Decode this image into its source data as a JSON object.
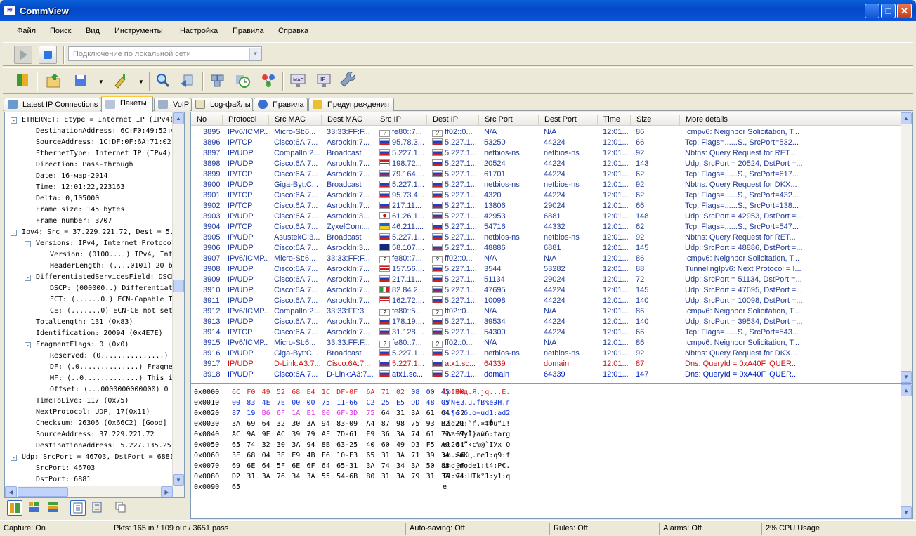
{
  "window": {
    "title": "CommView",
    "controls": [
      "minimize-icon",
      "maximize-icon",
      "close-icon"
    ]
  },
  "menu": [
    "Файл",
    "Поиск",
    "Вид",
    "Инструменты",
    "Настройка",
    "Правила",
    "Справка"
  ],
  "toolbar1": {
    "adapter_placeholder": "Подключение по локальной сети"
  },
  "tabs": [
    {
      "label": "Latest IP Connections",
      "icon": "ip-connections-icon"
    },
    {
      "label": "Пакеты",
      "icon": "packets-icon",
      "active": true
    },
    {
      "label": "VoIP",
      "icon": "voip-icon"
    },
    {
      "label": "Log-файлы",
      "icon": "log-icon"
    },
    {
      "label": "Правила",
      "icon": "rules-icon"
    },
    {
      "label": "Предупреждения",
      "icon": "alerts-icon"
    }
  ],
  "tree": [
    {
      "l": 0,
      "e": "-",
      "t": "ETHERNET: Etype = Internet IP (IPv4)"
    },
    {
      "l": 1,
      "t": "DestinationAddress: 6C:F0:49:52:68:E4"
    },
    {
      "l": 1,
      "t": "SourceAddress: 1C:DF:0F:6A:71:02"
    },
    {
      "l": 1,
      "t": "EthernetType: Internet IP (IPv4), 2048 (0x0800)"
    },
    {
      "l": 1,
      "t": "Direction: Pass-through"
    },
    {
      "l": 1,
      "t": "Date: 16-мар-2014"
    },
    {
      "l": 1,
      "t": "Time: 12:01:22,223163"
    },
    {
      "l": 1,
      "t": "Delta: 0,105000"
    },
    {
      "l": 1,
      "t": "Frame size: 145 bytes"
    },
    {
      "l": 1,
      "t": "Frame number: 3707"
    },
    {
      "l": 0,
      "e": "-",
      "t": "Ipv4: Src = 37.229.221.72, Dest = 5.227.135.25"
    },
    {
      "l": 1,
      "e": "-",
      "t": "Versions: IPv4, Internet Protocol; Header Length = 20"
    },
    {
      "l": 2,
      "t": "Version:      (0100....) IPv4, Internet Protocol"
    },
    {
      "l": 2,
      "t": "HeaderLength: (....0101) 20 bytes (0x5)"
    },
    {
      "l": 1,
      "e": "-",
      "t": "DifferentiatedServicesField: DSCP: 0, ECN: 0"
    },
    {
      "l": 2,
      "t": "DSCP: (000000..) Differentiated services codepoint 0"
    },
    {
      "l": 2,
      "t": "ECT:  (......0.) ECN-Capable Transport not set"
    },
    {
      "l": 2,
      "t": "CE:   (.......0) ECN-CE not set"
    },
    {
      "l": 1,
      "t": "TotalLength: 131 (0x83)"
    },
    {
      "l": 1,
      "t": "Identification: 20094 (0x4E7E)"
    },
    {
      "l": 1,
      "e": "-",
      "t": "FragmentFlags: 0 (0x0)"
    },
    {
      "l": 2,
      "t": "Reserved: (0...............)"
    },
    {
      "l": 2,
      "t": "DF:       (.0..............) Fragment if necessary"
    },
    {
      "l": 2,
      "t": "MF:       (..0.............) This is the last fragment"
    },
    {
      "l": 2,
      "t": "Offset:   (...0000000000000) 0"
    },
    {
      "l": 1,
      "t": "TimeToLive: 117 (0x75)"
    },
    {
      "l": 1,
      "t": "NextProtocol: UDP, 17(0x11)"
    },
    {
      "l": 1,
      "t": "Checksum: 26306 (0x66C2) [Good]"
    },
    {
      "l": 1,
      "t": "SourceAddress: 37.229.221.72"
    },
    {
      "l": 1,
      "t": "DestinationAddress: 5.227.135.25"
    },
    {
      "l": 0,
      "e": "-",
      "t": "Udp: SrcPort = 46703, DstPort = 6881, Length = 111"
    },
    {
      "l": 1,
      "t": "SrcPort: 46703"
    },
    {
      "l": 1,
      "t": "DstPort: 6881"
    },
    {
      "l": 1,
      "t": "TotalLength: 111 (0x6F)"
    }
  ],
  "packets": {
    "columns": [
      "No",
      "Protocol",
      "Src MAC",
      "Dest MAC",
      "Src IP",
      "Dest IP",
      "Src Port",
      "Dest Port",
      "Time",
      "Size",
      "More details"
    ],
    "rows": [
      [
        "3895",
        "IPv6/ICMP...",
        "Micro-St:6...",
        "33:33:FF:F...",
        "fe80::7...",
        "ff02::0...",
        "N/A",
        "N/A",
        "12:01...",
        "86",
        "Icmpv6: Neighbor Solicitation, T...",
        "q",
        "q",
        ""
      ],
      [
        "3896",
        "IP/TCP",
        "Cisco:6A:7...",
        "AsrockIn:7...",
        "95.78.3...",
        "5.227.1...",
        "53250",
        "44224",
        "12:01...",
        "66",
        "Tcp: Flags=......S., SrcPort=532...",
        "ru",
        "ru",
        ""
      ],
      [
        "3897",
        "IP/UDP",
        "CompalIn:2...",
        "Broadcast",
        "5.227.1...",
        "5.227.1...",
        "netbios-ns",
        "netbios-ns",
        "12:01...",
        "92",
        "Nbtns: Query Request for  RET...",
        "ru",
        "ru",
        ""
      ],
      [
        "3898",
        "IP/UDP",
        "Cisco:6A:7...",
        "AsrockIn:7...",
        "198.72...",
        "5.227.1...",
        "20524",
        "44224",
        "12:01...",
        "143",
        "Udp: SrcPort = 20524, DstPort =...",
        "us",
        "ru",
        ""
      ],
      [
        "3899",
        "IP/TCP",
        "Cisco:6A:7...",
        "AsrockIn:7...",
        "79.164....",
        "5.227.1...",
        "61701",
        "44224",
        "12:01...",
        "62",
        "Tcp: Flags=......S., SrcPort=617...",
        "ru",
        "ru",
        ""
      ],
      [
        "3900",
        "IP/UDP",
        "Giga-Byt:C...",
        "Broadcast",
        "5.227.1...",
        "5.227.1...",
        "netbios-ns",
        "netbios-ns",
        "12:01...",
        "92",
        "Nbtns: Query Request for  DKX...",
        "ru",
        "ru",
        ""
      ],
      [
        "3901",
        "IP/TCP",
        "Cisco:6A:7...",
        "AsrockIn:7...",
        "95.73.4...",
        "5.227.1...",
        "4320",
        "44224",
        "12:01...",
        "62",
        "Tcp: Flags=......S., SrcPort=432...",
        "ru",
        "ru",
        ""
      ],
      [
        "3902",
        "IP/TCP",
        "Cisco:6A:7...",
        "AsrockIn:7...",
        "217.11...",
        "5.227.1...",
        "13806",
        "29024",
        "12:01...",
        "66",
        "Tcp: Flags=......S., SrcPort=138...",
        "ru",
        "ru",
        ""
      ],
      [
        "3903",
        "IP/UDP",
        "Cisco:6A:7...",
        "AsrockIn:3...",
        "61.26.1...",
        "5.227.1...",
        "42953",
        "6881",
        "12:01...",
        "148",
        "Udp: SrcPort = 42953, DstPort =...",
        "jp",
        "ru",
        ""
      ],
      [
        "3904",
        "IP/TCP",
        "Cisco:6A:7...",
        "ZyxelCom:...",
        "46.211....",
        "5.227.1...",
        "54716",
        "44332",
        "12:01...",
        "62",
        "Tcp: Flags=......S., SrcPort=547...",
        "ua",
        "ru",
        ""
      ],
      [
        "3905",
        "IP/UDP",
        "AsustekC:3...",
        "Broadcast",
        "5.227.1...",
        "5.227.1...",
        "netbios-ns",
        "netbios-ns",
        "12:01...",
        "92",
        "Nbtns: Query Request for  RET...",
        "ru",
        "ru",
        ""
      ],
      [
        "3906",
        "IP/UDP",
        "Cisco:6A:7...",
        "AsrockIn:3...",
        "58.107....",
        "5.227.1...",
        "48886",
        "6881",
        "12:01...",
        "145",
        "Udp: SrcPort = 48886, DstPort =...",
        "au",
        "ru",
        ""
      ],
      [
        "3907",
        "IPv6/ICMP...",
        "Micro-St:6...",
        "33:33:FF:F...",
        "fe80::7...",
        "ff02::0...",
        "N/A",
        "N/A",
        "12:01...",
        "86",
        "Icmpv6: Neighbor Solicitation, T...",
        "q",
        "q",
        ""
      ],
      [
        "3908",
        "IP/UDP",
        "Cisco:6A:7...",
        "AsrockIn:7...",
        "157.56....",
        "5.227.1...",
        "3544",
        "53282",
        "12:01...",
        "88",
        "TunnelingIpv6: Next Protocol = I...",
        "us",
        "ru",
        ""
      ],
      [
        "3909",
        "IP/UDP",
        "Cisco:6A:7...",
        "AsrockIn:7...",
        "217.11...",
        "5.227.1...",
        "51134",
        "29024",
        "12:01...",
        "72",
        "Udp: SrcPort = 51134, DstPort =...",
        "ru",
        "ru",
        ""
      ],
      [
        "3910",
        "IP/UDP",
        "Cisco:6A:7...",
        "AsrockIn:7...",
        "82.84.2...",
        "5.227.1...",
        "47695",
        "44224",
        "12:01...",
        "145",
        "Udp: SrcPort = 47695, DstPort =...",
        "it",
        "ru",
        ""
      ],
      [
        "3911",
        "IP/UDP",
        "Cisco:6A:7...",
        "AsrockIn:7...",
        "162.72....",
        "5.227.1...",
        "10098",
        "44224",
        "12:01...",
        "140",
        "Udp: SrcPort = 10098, DstPort =...",
        "us",
        "ru",
        ""
      ],
      [
        "3912",
        "IPv6/ICMP...",
        "CompalIn:2...",
        "33:33:FF:3...",
        "fe80::5...",
        "ff02::0...",
        "N/A",
        "N/A",
        "12:01...",
        "86",
        "Icmpv6: Neighbor Solicitation, T...",
        "q",
        "q",
        ""
      ],
      [
        "3913",
        "IP/UDP",
        "Cisco:6A:7...",
        "AsrockIn:7...",
        "178.19....",
        "5.227.1...",
        "39534",
        "44224",
        "12:01...",
        "140",
        "Udp: SrcPort = 39534, DstPort =...",
        "ru",
        "ru",
        ""
      ],
      [
        "3914",
        "IP/TCP",
        "Cisco:6A:7...",
        "AsrockIn:7...",
        "31.128....",
        "5.227.1...",
        "54300",
        "44224",
        "12:01...",
        "66",
        "Tcp: Flags=......S., SrcPort=543...",
        "ru",
        "ru",
        ""
      ],
      [
        "3915",
        "IPv6/ICMP...",
        "Micro-St:6...",
        "33:33:FF:F...",
        "fe80::7...",
        "ff02::0...",
        "N/A",
        "N/A",
        "12:01...",
        "86",
        "Icmpv6: Neighbor Solicitation, T...",
        "q",
        "q",
        ""
      ],
      [
        "3916",
        "IP/UDP",
        "Giga-Byt:C...",
        "Broadcast",
        "5.227.1...",
        "5.227.1...",
        "netbios-ns",
        "netbios-ns",
        "12:01...",
        "92",
        "Nbtns: Query Request for  DKX...",
        "ru",
        "ru",
        ""
      ],
      [
        "3917",
        "IP/UDP",
        "D-Link:A3:7...",
        "Cisco:6A:7...",
        "5.227.1...",
        "atx1.sc...",
        "64339",
        "domain",
        "12:01...",
        "87",
        "Dns: QueryId = 0xA40F, QUER...",
        "ru",
        "ru",
        "red"
      ],
      [
        "3918",
        "IP/UDP",
        "Cisco:6A:7...",
        "D-Link:A3:7...",
        "atx1.sc...",
        "5.227.1...",
        "domain",
        "64339",
        "12:01...",
        "147",
        "Dns: QueryId = 0xA40F, QUER...",
        "ru",
        "ru",
        "blue"
      ]
    ]
  },
  "hex": [
    {
      "off": "0x0000",
      "b": [
        "6C",
        "F0",
        "49",
        "52",
        "68",
        "E4",
        "1C",
        "DF-0F",
        "6A",
        "71",
        "02",
        "08",
        "00",
        "45",
        "00"
      ],
      "a": "lpIRhд.Я.jq...E."
    },
    {
      "off": "0x0010",
      "b": [
        "00",
        "83",
        "4E",
        "7E",
        "00",
        "00",
        "75",
        "11-66",
        "C2",
        "25",
        "E5",
        "DD",
        "48",
        "05",
        "E3"
      ],
      "a": ".ѓN~..u.fВ%еЭH.г"
    },
    {
      "off": "0x0020",
      "b": [
        "87",
        "19",
        "B6",
        "6F",
        "1A",
        "E1",
        "00",
        "6F-3D",
        "75",
        "64",
        "31",
        "3A",
        "61",
        "64",
        "32"
      ],
      "a": "‡.¶o.б.o=ud1:ad2"
    },
    {
      "off": "0x0030",
      "b": [
        "3A",
        "69",
        "64",
        "32",
        "30",
        "3A",
        "94",
        "83-09",
        "A4",
        "87",
        "98",
        "75",
        "93",
        "B2",
        "21"
      ],
      "a": ":id20:”ѓ.¤‡�u“І!"
    },
    {
      "off": "0x0040",
      "b": [
        "AC",
        "9A",
        "9E",
        "AC",
        "39",
        "79",
        "AF",
        "7D-61",
        "E9",
        "36",
        "3A",
        "74",
        "61",
        "72",
        "67"
      ],
      "a": "¬љћ¬9yЇ}aй6:targ"
    },
    {
      "off": "0x0050",
      "b": [
        "65",
        "74",
        "32",
        "30",
        "3A",
        "94",
        "8B",
        "63-25",
        "40",
        "60",
        "49",
        "D3",
        "F5",
        "A0",
        "51"
      ],
      "a": "et20:”‹c%@`IУх Q"
    },
    {
      "off": "0x0060",
      "b": [
        "3E",
        "68",
        "04",
        "3E",
        "E9",
        "4B",
        "F6",
        "10-E3",
        "65",
        "31",
        "3A",
        "71",
        "39",
        "3A",
        "66"
      ],
      "a": ">h.>йKц.гe1:q9:f"
    },
    {
      "off": "0x0070",
      "b": [
        "69",
        "6E",
        "64",
        "5F",
        "6E",
        "6F",
        "64",
        "65-31",
        "3A",
        "74",
        "34",
        "3A",
        "50",
        "88",
        "0F"
      ],
      "a": "ind_node1:t4:P€."
    },
    {
      "off": "0x0080",
      "b": [
        "D2",
        "31",
        "3A",
        "76",
        "34",
        "3A",
        "55",
        "54-6B",
        "B0",
        "31",
        "3A",
        "79",
        "31",
        "3A",
        "71"
      ],
      "a": "Т1:v4:UTk°1:y1:q"
    },
    {
      "off": "0x0090",
      "b": [
        "65"
      ],
      "a": "e"
    }
  ],
  "status": [
    "Capture: On",
    "Pkts: 165 in / 109 out / 3651 pass",
    "Auto-saving: Off",
    "Rules: Off",
    "Alarms: Off",
    "2% CPU Usage"
  ],
  "colors": {
    "title_bar": "#0348c8",
    "hex_red": "#e02020",
    "hex_blue": "#1030d0",
    "hex_pink": "#e030e0",
    "row_red": "#d01010",
    "row_blue": "#0020c0"
  }
}
